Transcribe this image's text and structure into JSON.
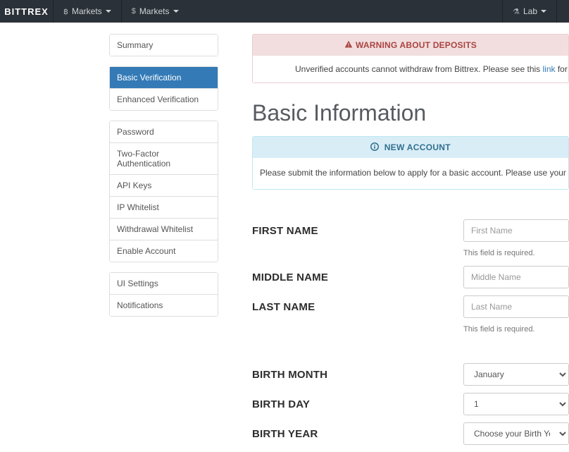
{
  "navbar": {
    "brand": "BITTREX",
    "items": [
      {
        "glyph": "฿",
        "label": "Markets"
      },
      {
        "glyph": "$",
        "label": "Markets"
      }
    ],
    "right": [
      {
        "glyph": "⚗",
        "label": "Lab"
      }
    ]
  },
  "sidebar": {
    "group1": [
      {
        "label": "Summary"
      }
    ],
    "group2": [
      {
        "label": "Basic Verification",
        "active": true
      },
      {
        "label": "Enhanced Verification"
      }
    ],
    "group3": [
      {
        "label": "Password"
      },
      {
        "label": "Two-Factor Authentication"
      },
      {
        "label": "API Keys"
      },
      {
        "label": "IP Whitelist"
      },
      {
        "label": "Withdrawal Whitelist"
      },
      {
        "label": "Enable Account"
      }
    ],
    "group4": [
      {
        "label": "UI Settings"
      },
      {
        "label": "Notifications"
      }
    ]
  },
  "warning": {
    "title": "WARNING ABOUT DEPOSITS",
    "body_prefix": "Unverified accounts cannot withdraw from Bittrex. Please see this ",
    "link_text": "link",
    "body_suffix": " for more informa"
  },
  "page_title": "Basic Information",
  "info_panel": {
    "title": "NEW ACCOUNT",
    "body": "Please submit the information below to apply for a basic account. Please use your full legal name as it exists on y"
  },
  "form": {
    "first_name": {
      "label": "FIRST NAME",
      "placeholder": "First Name",
      "help": "This field is required."
    },
    "middle_name": {
      "label": "MIDDLE NAME",
      "placeholder": "Middle Name"
    },
    "last_name": {
      "label": "LAST NAME",
      "placeholder": "Last Name",
      "help": "This field is required."
    },
    "birth_month": {
      "label": "BIRTH MONTH",
      "value": "January"
    },
    "birth_day": {
      "label": "BIRTH DAY",
      "value": "1"
    },
    "birth_year": {
      "label": "BIRTH YEAR",
      "value": "Choose your Birth Year ..."
    }
  }
}
